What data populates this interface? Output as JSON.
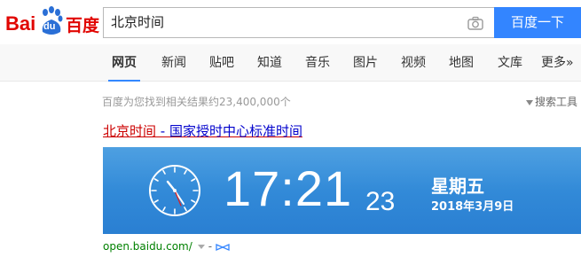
{
  "logo": {
    "latin_1": "Bai",
    "latin_2": "du",
    "chinese": "百度"
  },
  "search": {
    "query": "北京时间",
    "button_label": "百度一下"
  },
  "tabs": [
    {
      "label": "网页",
      "active": true
    },
    {
      "label": "新闻"
    },
    {
      "label": "贴吧"
    },
    {
      "label": "知道"
    },
    {
      "label": "音乐"
    },
    {
      "label": "图片"
    },
    {
      "label": "视频"
    },
    {
      "label": "地图"
    },
    {
      "label": "文库"
    },
    {
      "label": "更多»"
    }
  ],
  "results": {
    "count_text": "百度为您找到相关结果约23,400,000个",
    "tools_label": "搜索工具",
    "first": {
      "title_part1": "北京时间",
      "title_part2": " - 国家授时中心标准时间",
      "url": "open.baidu.com/",
      "url_sep": "-"
    }
  },
  "clock": {
    "hour_minute": "17:21",
    "second": "23",
    "weekday": "星期五",
    "date": "2018年3月9日"
  },
  "colors": {
    "brand_red": "#e10602",
    "search_blue": "#3385ff",
    "clock_bg": "#3a8fdc",
    "link_blue": "#0000cc",
    "url_green": "#008000"
  }
}
